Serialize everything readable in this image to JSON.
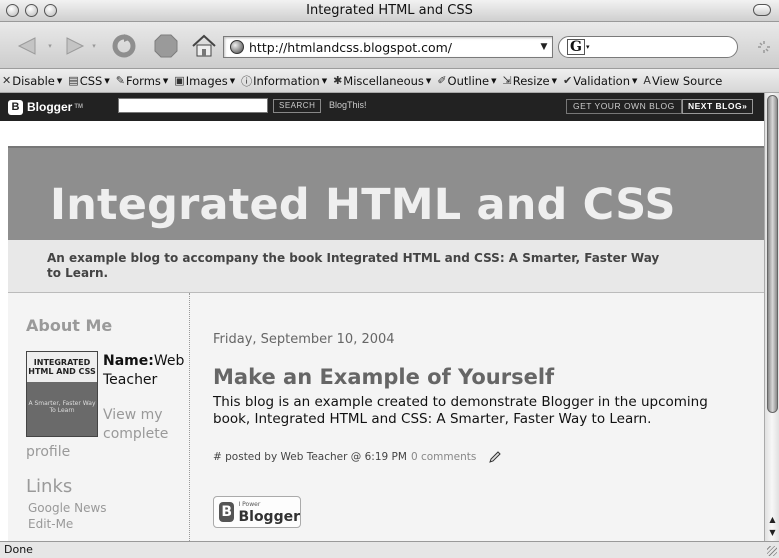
{
  "window": {
    "title": "Integrated HTML and CSS"
  },
  "nav": {
    "back_icon": "back-arrow-icon",
    "forward_icon": "forward-arrow-icon",
    "reload_icon": "reload-icon",
    "stop_icon": "stop-icon",
    "home_icon": "home-icon",
    "url": "http://htmlandcss.blogspot.com/",
    "search_engine_glyph": "G"
  },
  "devtoolbar": {
    "items": [
      {
        "label": "Disable",
        "icon": "disable-icon"
      },
      {
        "label": "CSS",
        "icon": "css-icon"
      },
      {
        "label": "Forms",
        "icon": "forms-icon"
      },
      {
        "label": "Images",
        "icon": "images-icon"
      },
      {
        "label": "Information",
        "icon": "information-icon"
      },
      {
        "label": "Miscellaneous",
        "icon": "miscellaneous-icon"
      },
      {
        "label": "Outline",
        "icon": "outline-icon"
      },
      {
        "label": "Resize",
        "icon": "resize-icon"
      },
      {
        "label": "Validation",
        "icon": "validation-icon"
      },
      {
        "label": "View Source",
        "icon": "view-source-icon"
      }
    ]
  },
  "blogger_bar": {
    "logo_text": "Blogger",
    "tm": "TM",
    "search_button": "SEARCH",
    "blog_this": "BlogThis!",
    "get_own_blog": "GET YOUR OWN BLOG",
    "next_blog": "NEXT BLOG»"
  },
  "blog": {
    "title": "Integrated HTML and CSS",
    "description": "An example blog to accompany the book Integrated HTML and CSS: A Smarter, Faster Way to Learn."
  },
  "sidebar": {
    "about_heading": "About Me",
    "book_cover_title": "INTEGRATED HTML AND CSS",
    "book_cover_sub": "A Smarter, Faster Way To Learn",
    "name_label": "Name:",
    "name_value": "Web Teacher",
    "view_profile_1": "View my complete",
    "view_profile_2": "profile",
    "links_heading": "Links",
    "links": [
      "Google News",
      "Edit-Me"
    ]
  },
  "post": {
    "date": "Friday, September 10, 2004",
    "title": "Make an Example of Yourself",
    "body": "This blog is an example created to demonstrate Blogger in the upcoming book, Integrated HTML and CSS: A Smarter, Faster Way to Learn.",
    "footer_prefix": "# posted by Web Teacher @ 6:19 PM",
    "comments": "0 comments",
    "edit_icon": "pencil-icon"
  },
  "powered_by": {
    "small": "I Power",
    "big": "Blogger"
  },
  "status": {
    "text": "Done"
  }
}
